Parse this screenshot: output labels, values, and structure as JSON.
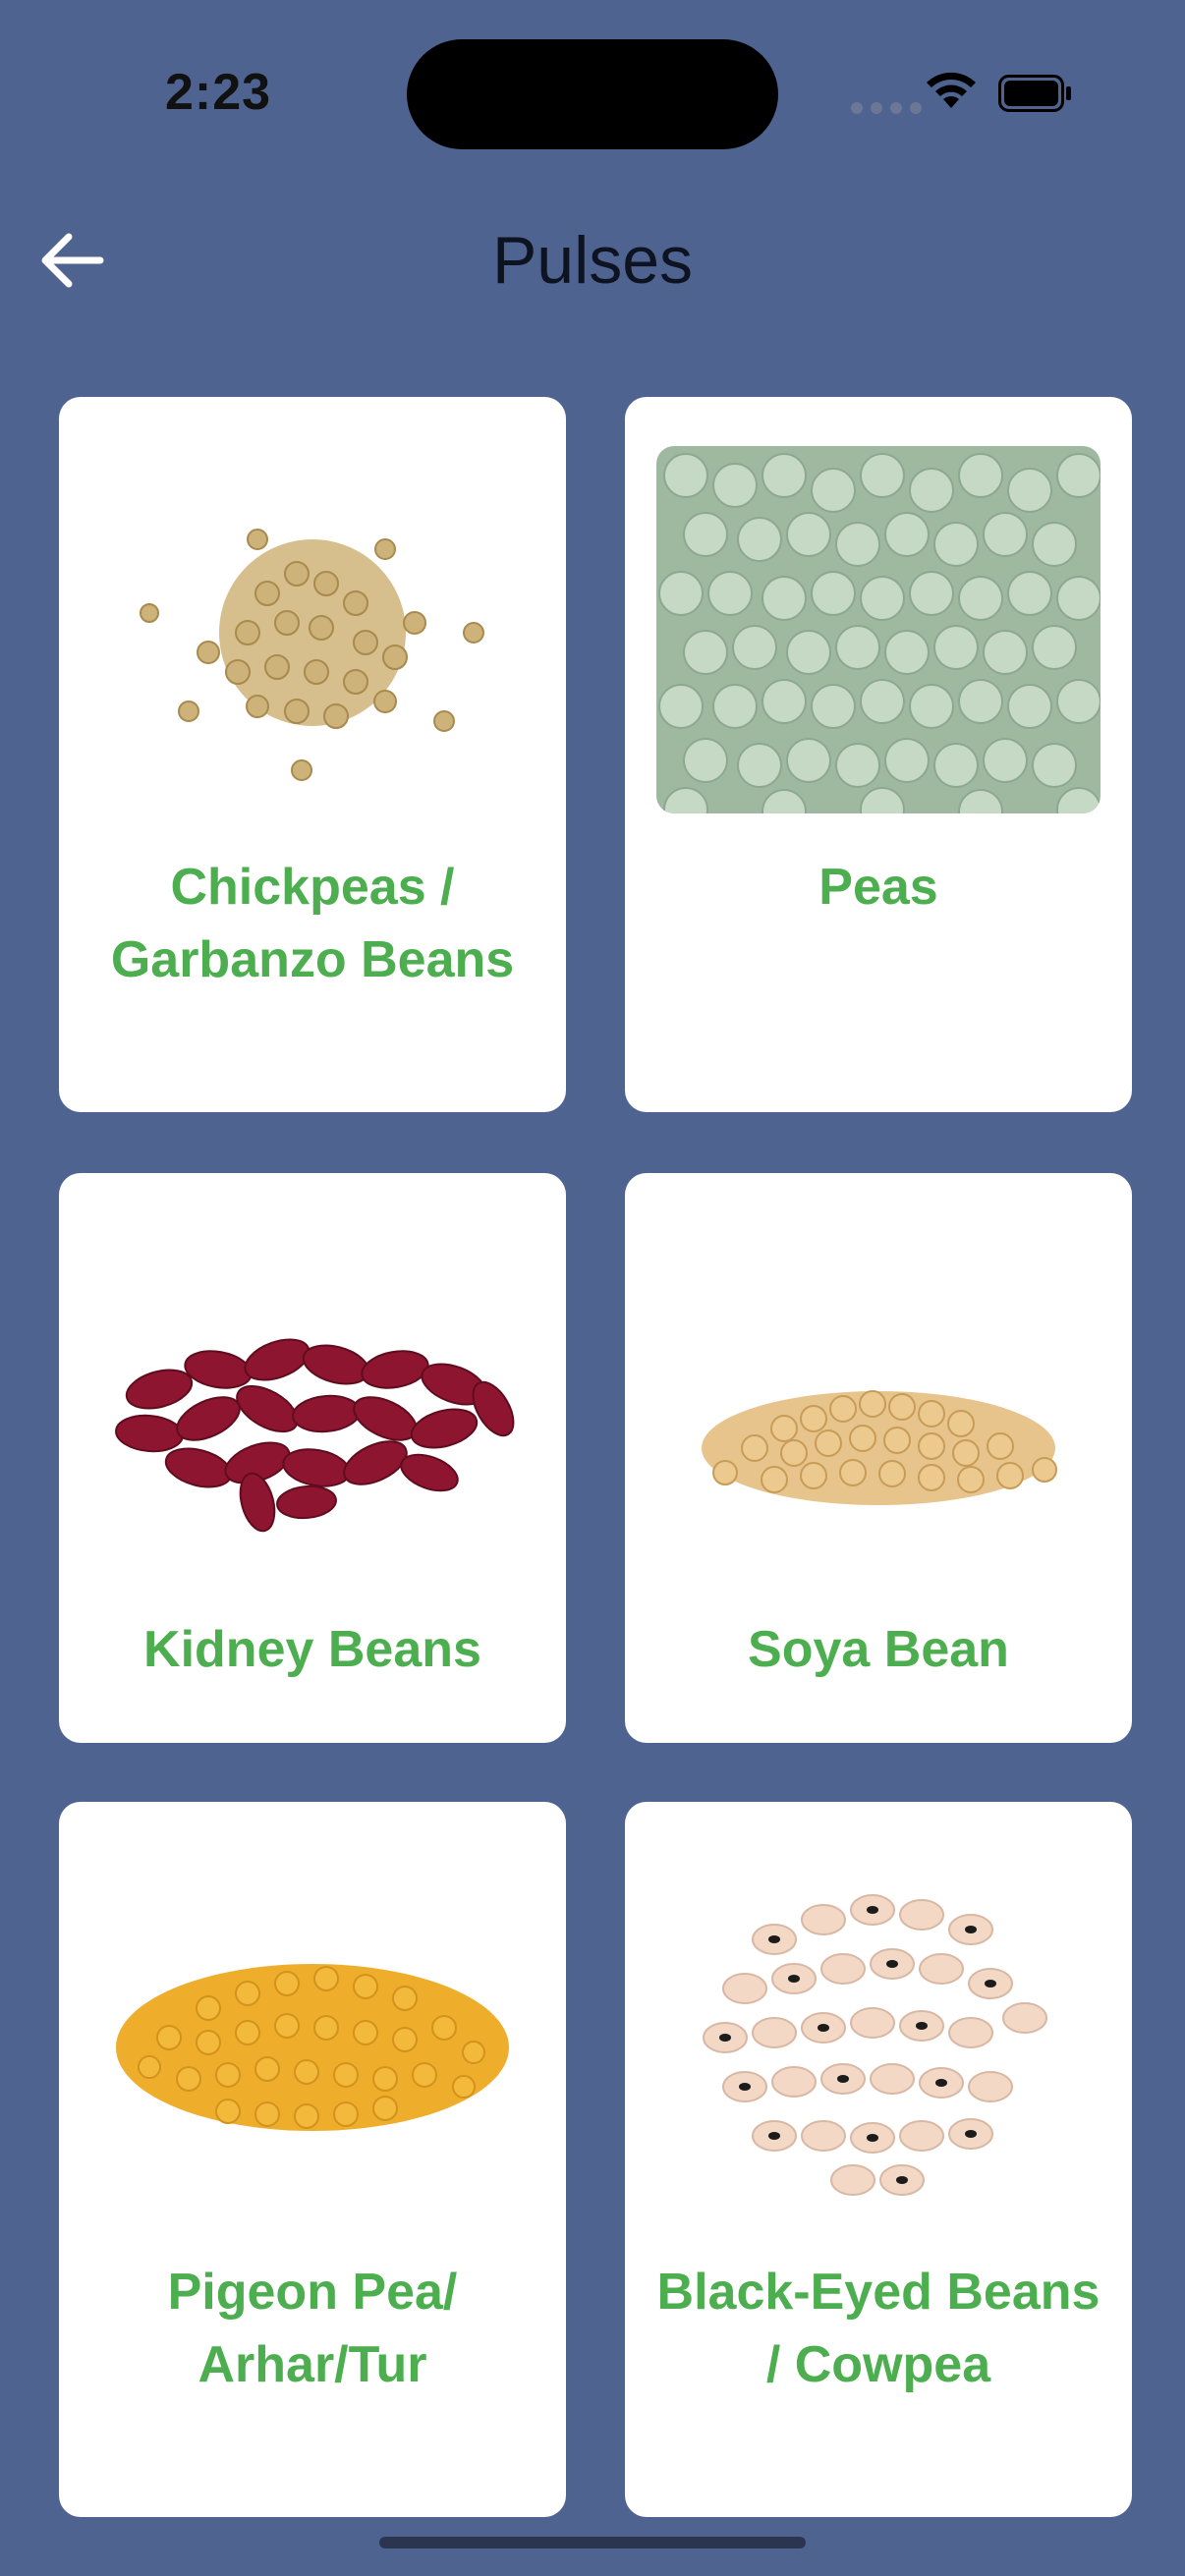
{
  "status_bar": {
    "time": "2:23"
  },
  "header": {
    "title": "Pulses",
    "back_icon": "arrow-left-icon"
  },
  "colors": {
    "background": "#4f6390",
    "card": "#ffffff",
    "label": "#4cae4f"
  },
  "items": [
    {
      "label": "Chickpeas / Garbanzo Beans"
    },
    {
      "label": "Peas"
    },
    {
      "label": "Kidney Beans"
    },
    {
      "label": "Soya Bean"
    },
    {
      "label": "Pigeon Pea/ Arhar/Tur"
    },
    {
      "label": "Black-Eyed Beans / Cowpea"
    }
  ]
}
